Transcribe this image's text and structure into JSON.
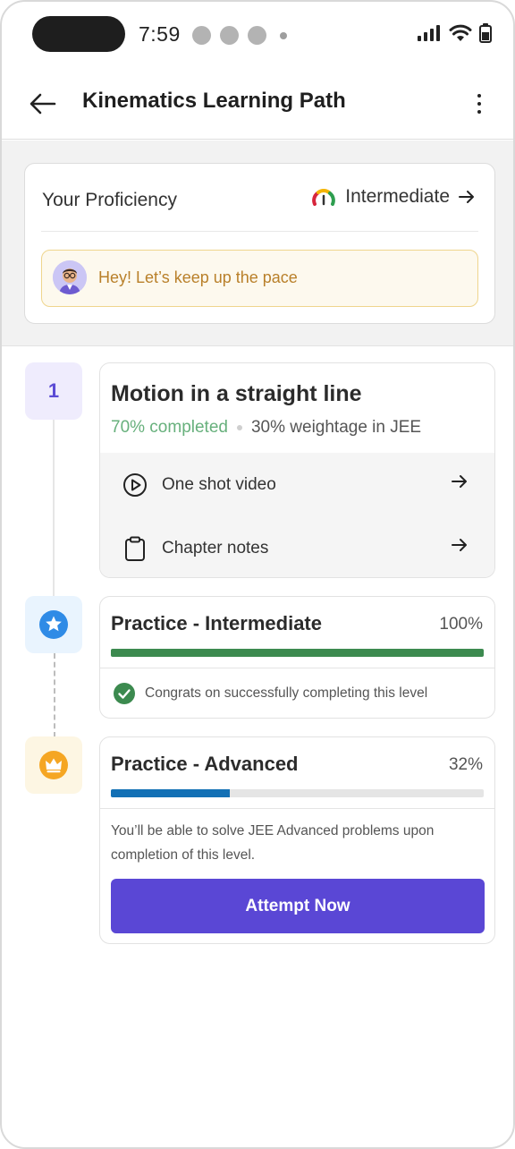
{
  "status_bar": {
    "time": "7:59"
  },
  "header": {
    "title": "Kinematics Learning Path"
  },
  "proficiency": {
    "label": "Your Proficiency",
    "level": "Intermediate",
    "message": "Hey! Let’s keep up the pace"
  },
  "steps": {
    "step1": {
      "number": "1",
      "title": "Motion in a straight line",
      "completed": "70% completed",
      "weightage": "30% weightage in JEE",
      "resources": [
        {
          "label": "One shot video",
          "icon": "play-circle-icon"
        },
        {
          "label": "Chapter notes",
          "icon": "clipboard-icon"
        }
      ]
    },
    "step2": {
      "title": "Practice - Intermediate",
      "percent_text": "100%",
      "progress": 1.0,
      "message": "Congrats on successfully completing this level",
      "color": "#3c8a4f"
    },
    "step3": {
      "title": "Practice - Advanced",
      "percent_text": "32%",
      "progress": 0.32,
      "description": "You’ll be able to solve JEE Advanced problems upon completion of this level.",
      "button_label": "Attempt Now",
      "color": "#1370b5"
    }
  },
  "colors": {
    "accent": "#5a47d5",
    "success": "#3c8a4f",
    "progress_blue": "#1370b5",
    "pace_text": "#b9802a"
  }
}
